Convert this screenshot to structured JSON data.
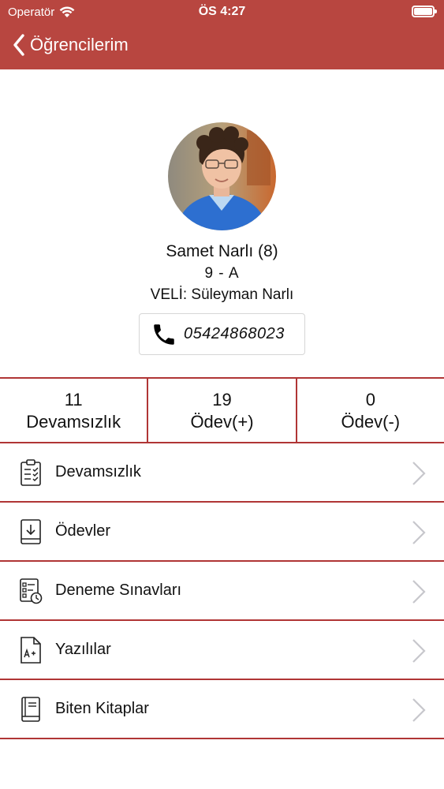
{
  "status_bar": {
    "carrier": "Operatör",
    "time": "ÖS 4:27"
  },
  "nav": {
    "back_label": "Öğrencilerim"
  },
  "profile": {
    "name": "Samet Narlı (8)",
    "class": "9 - A",
    "parent": "VELİ: Süleyman Narlı",
    "phone": "05424868023"
  },
  "stats": [
    {
      "value": "11",
      "label": "Devamsızlık"
    },
    {
      "value": "19",
      "label": "Ödev(+)"
    },
    {
      "value": "0",
      "label": "Ödev(-)"
    }
  ],
  "menu": [
    {
      "label": "Devamsızlık",
      "icon": "clipboard-checklist-icon"
    },
    {
      "label": "Ödevler",
      "icon": "book-download-icon"
    },
    {
      "label": "Deneme Sınavları",
      "icon": "exam-list-timer-icon"
    },
    {
      "label": "Yazılılar",
      "icon": "document-grade-icon"
    },
    {
      "label": "Biten Kitaplar",
      "icon": "book-icon"
    }
  ],
  "colors": {
    "header": "#b84640",
    "divider": "#b03535"
  }
}
